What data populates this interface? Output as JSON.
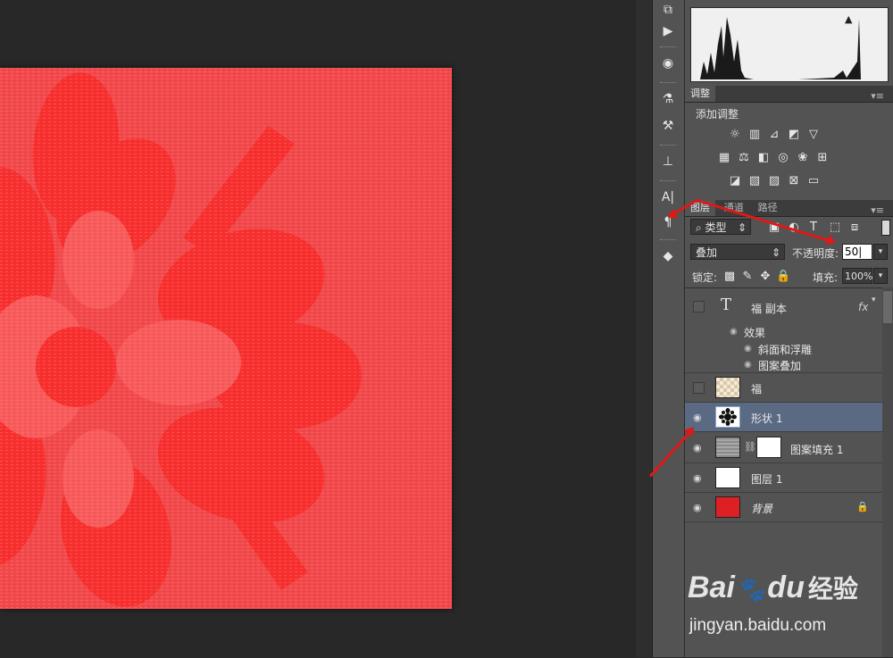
{
  "app": {
    "accent_selected": "#596a82",
    "canvas_color": "#f24a4c"
  },
  "adjustments": {
    "tab": "调整",
    "title": "添加调整"
  },
  "layers_panel": {
    "tabs": [
      "图层",
      "通道",
      "路径"
    ],
    "filter_label": "类型",
    "blend_mode": "叠加",
    "opacity_label": "不透明度:",
    "opacity_value": "50",
    "lock_label": "锁定:",
    "fill_label": "填充:",
    "fill_value": "100%",
    "layers": [
      {
        "name": "福 副本",
        "fx": "fx",
        "effects_label": "效果",
        "effects": [
          "斜面和浮雕",
          "图案叠加"
        ]
      },
      {
        "name": "福"
      },
      {
        "name": "形状 1"
      },
      {
        "name": "图案填充 1"
      },
      {
        "name": "图层 1"
      },
      {
        "name": "背景"
      }
    ]
  },
  "watermark": {
    "brand": "Bai",
    "brand2": "du",
    "product": "经验",
    "url": "jingyan.baidu.com"
  }
}
